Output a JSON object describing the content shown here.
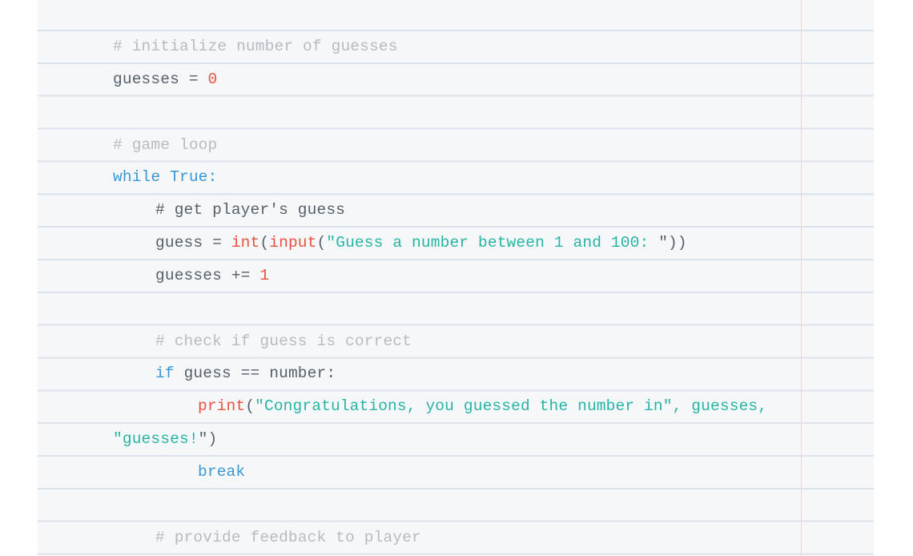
{
  "document": {
    "type": "lined-paper code listing",
    "indent_unit": "    ",
    "colors": {
      "paper": "#f6f7f8",
      "rule_line": "#dde3ea",
      "margin_line": "#f5d9a0",
      "comment": "#b5bcc2",
      "plain": "#55606b",
      "number": "#e8523f",
      "keyword": "#3a97d4",
      "builtin": "#e8523f",
      "string": "#26b4a4"
    },
    "lines": [
      {
        "indent": 0,
        "tokens": [
          {
            "t": "comment",
            "v": "# initialize number of guesses"
          }
        ]
      },
      {
        "indent": 0,
        "tokens": [
          {
            "t": "plain",
            "v": "guesses = "
          },
          {
            "t": "number",
            "v": "0"
          }
        ]
      },
      {
        "indent": 0,
        "tokens": []
      },
      {
        "indent": 0,
        "tokens": [
          {
            "t": "comment",
            "v": "# game loop"
          }
        ]
      },
      {
        "indent": 0,
        "tokens": [
          {
            "t": "keyword",
            "v": "while True:"
          }
        ]
      },
      {
        "indent": 1,
        "tokens": [
          {
            "t": "comment-dark",
            "v": "# get player's guess"
          }
        ]
      },
      {
        "indent": 1,
        "tokens": [
          {
            "t": "plain",
            "v": "guess = "
          },
          {
            "t": "builtin",
            "v": "int"
          },
          {
            "t": "plain",
            "v": "("
          },
          {
            "t": "builtin",
            "v": "input"
          },
          {
            "t": "plain",
            "v": "("
          },
          {
            "t": "string",
            "v": "\"Guess a number between 1 and 100: "
          },
          {
            "t": "plain",
            "v": "\"))"
          }
        ]
      },
      {
        "indent": 1,
        "tokens": [
          {
            "t": "plain",
            "v": "guesses += "
          },
          {
            "t": "number",
            "v": "1"
          }
        ]
      },
      {
        "indent": 0,
        "tokens": []
      },
      {
        "indent": 1,
        "tokens": [
          {
            "t": "comment",
            "v": "# check if guess is correct"
          }
        ]
      },
      {
        "indent": 1,
        "tokens": [
          {
            "t": "keyword",
            "v": "if"
          },
          {
            "t": "plain",
            "v": " guess == number:"
          }
        ]
      },
      {
        "indent": 2,
        "tokens": [
          {
            "t": "builtin",
            "v": "print"
          },
          {
            "t": "plain",
            "v": "("
          },
          {
            "t": "string",
            "v": "\"Congratulations, you guessed the number in\", guesses,"
          }
        ]
      },
      {
        "indent": 0,
        "tokens": [
          {
            "t": "string",
            "v": "\"guesses!"
          },
          {
            "t": "plain",
            "v": "\")"
          }
        ]
      },
      {
        "indent": 2,
        "tokens": [
          {
            "t": "keyword",
            "v": "break"
          }
        ]
      },
      {
        "indent": 0,
        "tokens": []
      },
      {
        "indent": 1,
        "tokens": [
          {
            "t": "comment",
            "v": "# provide feedback to player"
          }
        ]
      }
    ]
  }
}
